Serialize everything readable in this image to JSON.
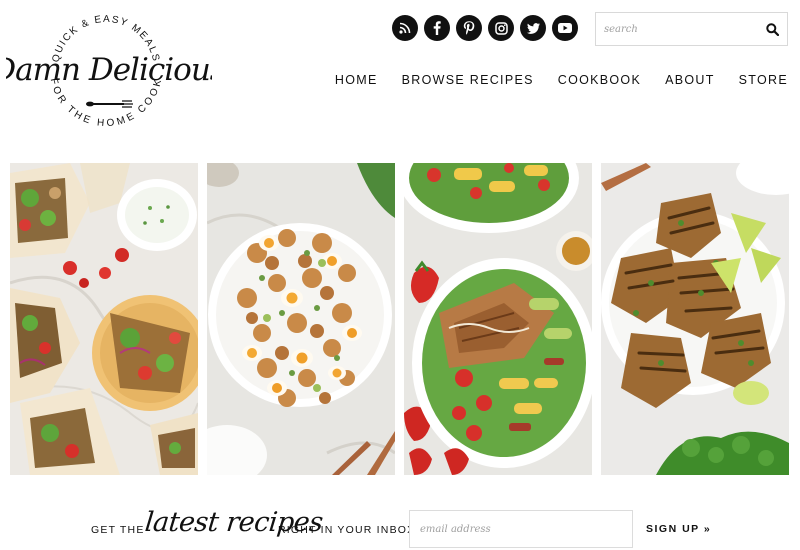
{
  "logo": {
    "top_arc_text": "QUICK & EASY MEALS",
    "wordmark": "Damn Delicious",
    "bottom_arc_text": "FOR THE HOME COOK"
  },
  "social": {
    "icons": [
      "rss-icon",
      "facebook-icon",
      "pinterest-icon",
      "instagram-icon",
      "twitter-icon",
      "youtube-icon"
    ],
    "color": "#111111"
  },
  "search": {
    "placeholder": "search"
  },
  "nav": {
    "items": [
      "HOME",
      "BROWSE RECIPES",
      "COOKBOOK",
      "ABOUT",
      "STORE"
    ]
  },
  "recipes": [
    {
      "image": "gyros-with-tzatziki-photo"
    },
    {
      "image": "potato-egg-salad-photo"
    },
    {
      "image": "chicken-strawberry-salad-photo"
    },
    {
      "image": "grilled-chicken-with-lime-photo"
    }
  ],
  "newsletter": {
    "prefix": "GET THE",
    "script": "latest recipes",
    "suffix": "RIGHT IN YOUR INBOX:",
    "email_placeholder": "email address",
    "signup_label": "SIGN UP »"
  }
}
